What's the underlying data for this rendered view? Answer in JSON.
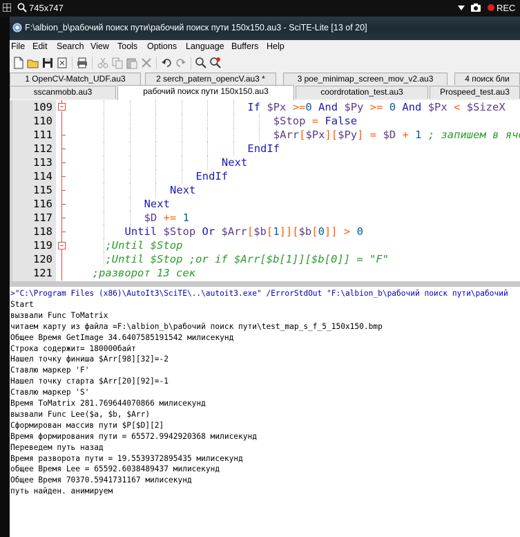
{
  "recorder": {
    "size_label": "745x747",
    "rec_label": "REC"
  },
  "window": {
    "title": "F:\\albion_b\\рабочий поиск пути\\рабочий поиск пути 150x150.au3 - SciTE-Lite [13 of 20]"
  },
  "menu": [
    "File",
    "Edit",
    "Search",
    "View",
    "Tools",
    "Options",
    "Language",
    "Buffers",
    "Help"
  ],
  "tabs_row1": [
    "1 OpenCV-Match_UDF.au3",
    "2 serch_patern_opencV.au3 *",
    "3 poe_minimap_screen_mov_v2.au3",
    "4 поиск бли"
  ],
  "tabs_row2": [
    "sscanmobb.au3",
    "рабочий поиск пути 150x150.au3",
    "coordrotation_test.au3",
    "Prospeed_test.au3"
  ],
  "active_tab": "рабочий поиск пути 150x150.au3",
  "editor": {
    "line_numbers": [
      "109",
      "110",
      "111",
      "112",
      "113",
      "114",
      "115",
      "116",
      "117",
      "118",
      "119",
      "120",
      "121"
    ],
    "lines": [
      [
        [
          "kw",
          "If "
        ],
        [
          "var",
          "$Px "
        ],
        [
          "op",
          ">="
        ],
        [
          "num",
          "0 "
        ],
        [
          "kw",
          "And "
        ],
        [
          "var",
          "$Py "
        ],
        [
          "op",
          ">= "
        ],
        [
          "num",
          "0 "
        ],
        [
          "kw",
          "And "
        ],
        [
          "var",
          "$Px "
        ],
        [
          "op",
          "< "
        ],
        [
          "var",
          "$SizeX "
        ]
      ],
      [
        [
          "var",
          "$Stop "
        ],
        [
          "op",
          "= "
        ],
        [
          "kw",
          "False"
        ]
      ],
      [
        [
          "var",
          "$Arr"
        ],
        [
          "op",
          "["
        ],
        [
          "var",
          "$Px"
        ],
        [
          "op",
          "]["
        ],
        [
          "var",
          "$Py"
        ],
        [
          "op",
          "] = "
        ],
        [
          "var",
          "$D "
        ],
        [
          "op",
          "+ "
        ],
        [
          "num",
          "1 "
        ],
        [
          "cm",
          "; запишем в ячейку"
        ]
      ],
      [
        [
          "kw",
          "EndIf"
        ]
      ],
      [
        [
          "kw",
          "Next"
        ]
      ],
      [
        [
          "kw",
          "EndIf"
        ]
      ],
      [
        [
          "kw",
          "Next"
        ]
      ],
      [
        [
          "kw",
          "Next"
        ]
      ],
      [
        [
          "var",
          "$D "
        ],
        [
          "op",
          "+= "
        ],
        [
          "num",
          "1"
        ]
      ],
      [
        [
          "kw",
          "Until "
        ],
        [
          "var",
          "$Stop "
        ],
        [
          "kw",
          "Or "
        ],
        [
          "var",
          "$Arr"
        ],
        [
          "op",
          "["
        ],
        [
          "var",
          "$b"
        ],
        [
          "op",
          "["
        ],
        [
          "num",
          "1"
        ],
        [
          "op",
          "]]["
        ],
        [
          "var",
          "$b"
        ],
        [
          "op",
          "["
        ],
        [
          "num",
          "0"
        ],
        [
          "op",
          "]] > "
        ],
        [
          "num",
          "0"
        ]
      ],
      [
        [
          "cm",
          ";Until $Stop"
        ]
      ],
      [
        [
          "cm",
          ";Until $Stop ;or if $Arr[$b[1]][$b[0]] = \"F\""
        ]
      ],
      [
        [
          "cm",
          ";разворот 13 сек"
        ]
      ]
    ]
  },
  "output": [
    ">\"C:\\Program Files (x86)\\AutoIt3\\SciTE\\..\\autoit3.exe\" /ErrorStdOut \"F:\\albion_b\\рабочий поиск пути\\рабочий",
    "Start",
    "вызвали Func ToMatrix",
    "читаем карту из файла =F:\\albion_b\\рабочий поиск пути\\test_map_s_f_5_150x150.bmp",
    "Общее Время GetImage 34.6407585191542 милисекунд",
    "Строка содержит= 180000байт",
    "Нашел точку финиша $Arr[98][32]=-2",
    "Ставлю маркер 'F'",
    "Нашел точку старта $Arr[20][92]=-1",
    "Ставлю маркер 'S'",
    "Время ToMatrix 281.769644070866 милисекунд",
    "вызвали Func Lee($a, $b, $Arr)",
    "Сформирован массив пути $P[$D][2]",
    "Время формирования пути = 65572.9942920368 милисекунд",
    "Переведем путь назад",
    "Время разворота пути = 19.5539372895435 милисекунд",
    "общее Время Lee = 65592.6038489437 милисекунд",
    "Общее Время 70370.5941731167 милисекунд",
    "путь найден. анимируем"
  ]
}
